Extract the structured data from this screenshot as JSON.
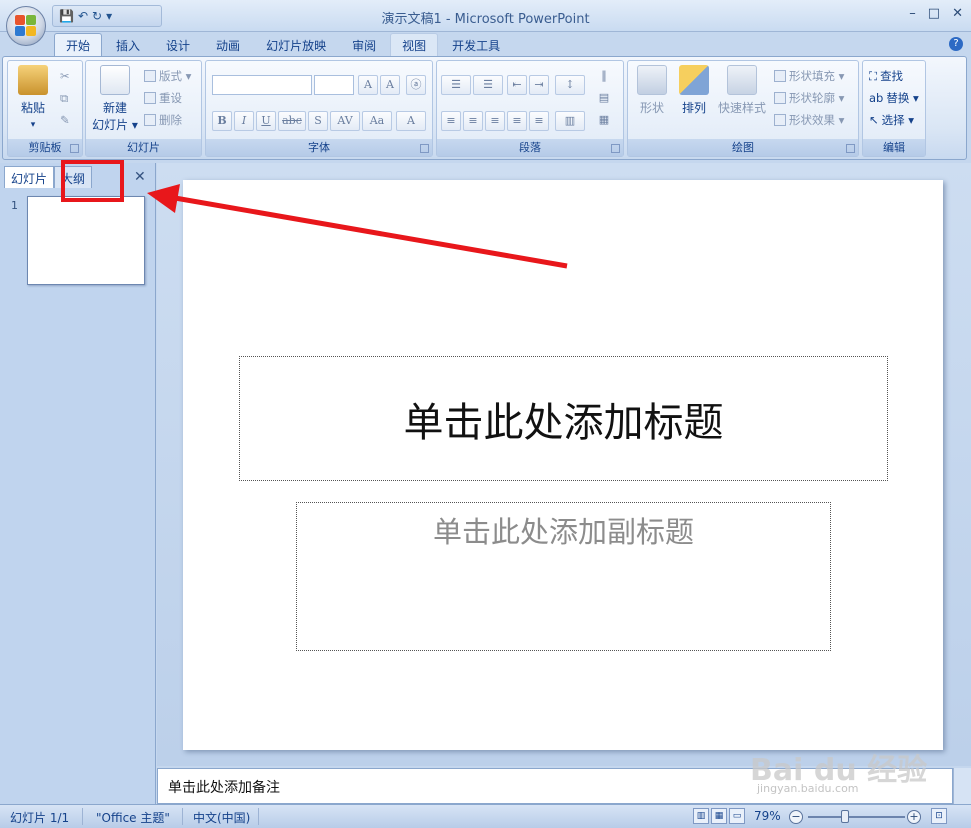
{
  "window": {
    "title": "演示文稿1 - Microsoft PowerPoint",
    "controls": [
      "–",
      "□",
      "✕"
    ]
  },
  "qat": {
    "save": "💾",
    "undo": "↶",
    "redo": "↻",
    "more": "▾"
  },
  "ribbon": {
    "tabs": [
      "开始",
      "插入",
      "设计",
      "动画",
      "幻灯片放映",
      "审阅",
      "视图",
      "开发工具"
    ],
    "active_tab": "开始",
    "clipboard": {
      "label": "剪贴板",
      "paste": "粘贴"
    },
    "slides": {
      "label": "幻灯片",
      "new_slide_line1": "新建",
      "new_slide_line2": "幻灯片 ▾",
      "layout": "版式 ▾",
      "reset": "重设",
      "delete": "删除"
    },
    "font": {
      "label": "字体",
      "buttons": [
        "B",
        "I",
        "U",
        "abc",
        "S",
        "AV",
        "Aa",
        "A"
      ]
    },
    "paragraph": {
      "label": "段落"
    },
    "drawing": {
      "label": "绘图",
      "shapes": "形状",
      "arrange": "排列",
      "quick_styles": "快速样式",
      "shape_fill": "形状填充 ▾",
      "shape_outline": "形状轮廓 ▾",
      "shape_effects": "形状效果 ▾"
    },
    "editing": {
      "label": "编辑",
      "find": "查找",
      "replace": "替换 ▾",
      "select": "选择 ▾"
    }
  },
  "left_pane": {
    "tabs": [
      "幻灯片",
      "大纲"
    ],
    "active_tab": "幻灯片",
    "close": "✕",
    "slide_number": "1"
  },
  "slide": {
    "title_placeholder": "单击此处添加标题",
    "subtitle_placeholder": "单击此处添加副标题"
  },
  "notes": {
    "placeholder": "单击此处添加备注"
  },
  "status_bar": {
    "slide_counter": "幻灯片 1/1",
    "theme": "\"Office 主题\"",
    "language": "中文(中国)",
    "zoom": "79%"
  },
  "watermark": {
    "brand": "Bai du 经验",
    "url": "jingyan.baidu.com"
  },
  "colors": {
    "annotation_red": "#e8171b",
    "ribbon_text": "#15428b"
  }
}
